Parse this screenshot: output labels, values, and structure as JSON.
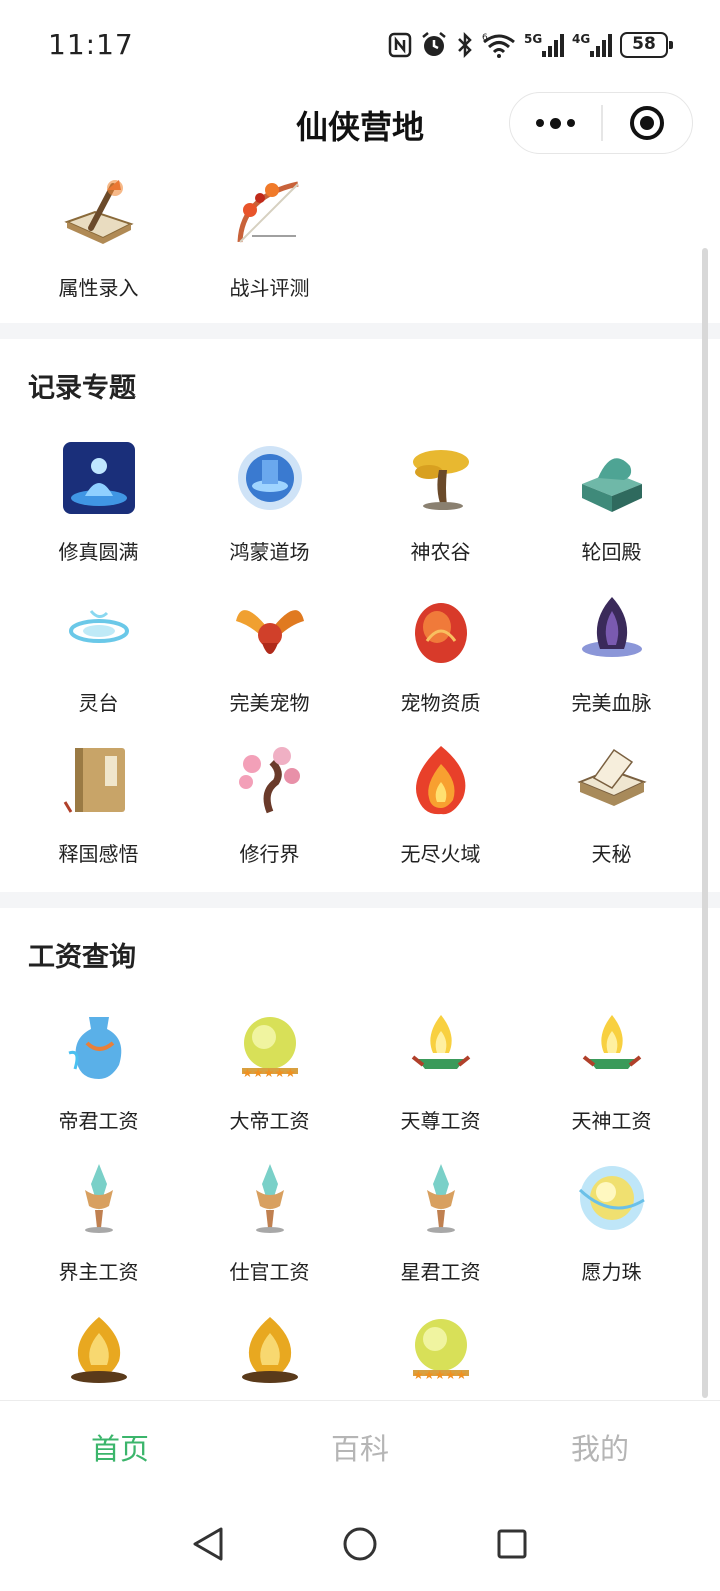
{
  "status_bar": {
    "time": "11:17",
    "battery": "58",
    "icons": [
      "nfc-icon",
      "alarm-icon",
      "bluetooth-icon",
      "wifi-icon",
      "signal-5g-icon",
      "signal-4g-icon",
      "battery-icon"
    ],
    "network_5g": "5G",
    "network_4g": "4G"
  },
  "nav": {
    "title": "仙侠营地"
  },
  "tools": [
    {
      "label": "属性录入",
      "icon": "book-sword-icon"
    },
    {
      "label": "战斗评测",
      "icon": "bow-icon"
    }
  ],
  "sections": [
    {
      "title": "记录专题",
      "items": [
        {
          "label": "修真圆满",
          "icon": "meditation-icon"
        },
        {
          "label": "鸿蒙道场",
          "icon": "portal-icon"
        },
        {
          "label": "神农谷",
          "icon": "golden-tree-icon"
        },
        {
          "label": "轮回殿",
          "icon": "jade-seal-icon"
        },
        {
          "label": "灵台",
          "icon": "water-swirl-icon"
        },
        {
          "label": "完美宠物",
          "icon": "phoenix-icon"
        },
        {
          "label": "宠物资质",
          "icon": "dragon-egg-icon"
        },
        {
          "label": "完美血脉",
          "icon": "dark-flame-icon"
        },
        {
          "label": "释国感悟",
          "icon": "scripture-icon"
        },
        {
          "label": "修行界",
          "icon": "plum-tree-icon"
        },
        {
          "label": "无尽火域",
          "icon": "fire-icon"
        },
        {
          "label": "天秘",
          "icon": "open-book-icon"
        }
      ]
    },
    {
      "title": "工资查询",
      "items": [
        {
          "label": "帝君工资",
          "icon": "water-vase-icon"
        },
        {
          "label": "大帝工资",
          "icon": "star-orb-icon"
        },
        {
          "label": "天尊工资",
          "icon": "flame-brazier-icon"
        },
        {
          "label": "天神工资",
          "icon": "flame-brazier-icon"
        },
        {
          "label": "界主工资",
          "icon": "crystal-dagger-icon"
        },
        {
          "label": "仕官工资",
          "icon": "crystal-dagger-icon"
        },
        {
          "label": "星君工资",
          "icon": "crystal-dagger-icon"
        },
        {
          "label": "愿力珠",
          "icon": "wish-pearl-icon"
        },
        {
          "label": "",
          "icon": "golden-flame-icon"
        },
        {
          "label": "",
          "icon": "golden-flame-icon"
        },
        {
          "label": "",
          "icon": "star-orb-icon"
        }
      ]
    }
  ],
  "tabbar": {
    "tabs": [
      {
        "label": "首页",
        "active": true
      },
      {
        "label": "百科",
        "active": false
      },
      {
        "label": "我的",
        "active": false
      }
    ],
    "active_color": "#3bb56b",
    "inactive_color": "#b5b5b5"
  },
  "colors": {
    "background": "#ffffff",
    "section_gap": "#f4f5f7",
    "text": "#222222"
  }
}
